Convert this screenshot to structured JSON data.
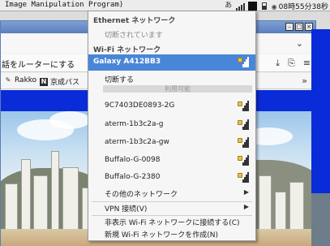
{
  "panel": {
    "title": "Image Manipulation Program)",
    "ime": "あ",
    "clock": "08時55分38秒"
  },
  "browser": {
    "page_text": "話をルーターにする",
    "bookmarks": [
      "Rakko",
      "京成バス"
    ]
  },
  "network_menu": {
    "ethernet_header": "Ethernet ネットワーク",
    "ethernet_status": "切断されています",
    "wifi_header": "Wi-Fi ネットワーク",
    "connected_network": "Galaxy A412BB3",
    "disconnect": "切断する",
    "available_label": "利用可能",
    "networks": [
      "9C7403DE0893-2G",
      "aterm-1b3c2a-g",
      "aterm-1b3c2a-gw",
      "Buffalo-G-0098",
      "Buffalo-G-2380"
    ],
    "other_networks": "その他のネットワーク",
    "vpn": "VPN 接続(V)",
    "connect_hidden": "非表示 Wi-Fi ネットワークに接続する(C)",
    "create_new": "新規 Wi-Fi ネットワークを作成(N)"
  },
  "colors": {
    "selection": "#4a86d8",
    "lock": "#e9c34a",
    "banner_blue": "#0a2bd8"
  }
}
